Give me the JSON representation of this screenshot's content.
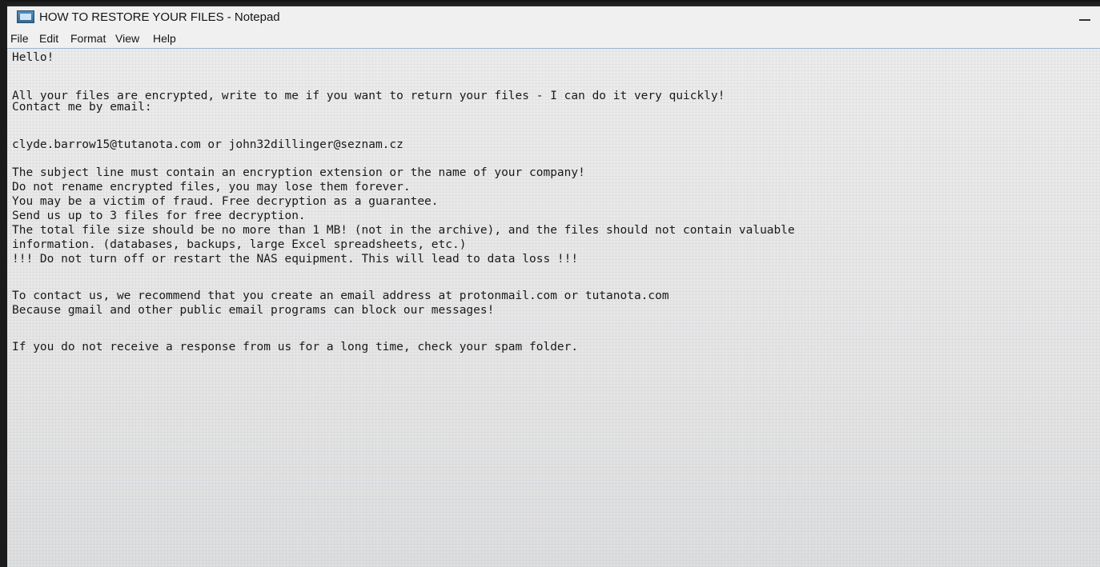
{
  "window": {
    "title": "HOW TO RESTORE YOUR FILES - Notepad"
  },
  "menu": {
    "items": [
      "File",
      "Edit",
      "Format",
      "View",
      "Help"
    ]
  },
  "document": {
    "lines": [
      "Hello!",
      "",
      "All your files are encrypted, write to me if you want to return your files - I can do it very quickly!",
      "Contact me by email:",
      "",
      "clyde.barrow15@tutanota.com or john32dillinger@seznam.cz",
      "",
      "The subject line must contain an encryption extension or the name of your company!",
      "Do not rename encrypted files, you may lose them forever.",
      "You may be a victim of fraud. Free decryption as a guarantee.",
      "Send us up to 3 files for free decryption.",
      "The total file size should be no more than 1 MB! (not in the archive), and the files should not contain valuable",
      "information. (databases, backups, large Excel spreadsheets, etc.)",
      "!!! Do not turn off or restart the NAS equipment. This will lead to data loss !!!",
      "",
      "To contact us, we recommend that you create an email address at protonmail.com or tutanota.com",
      "Because gmail and other public email programs can block our messages!",
      "",
      "If you do not receive a response from us for a long time, check your spam folder."
    ]
  }
}
